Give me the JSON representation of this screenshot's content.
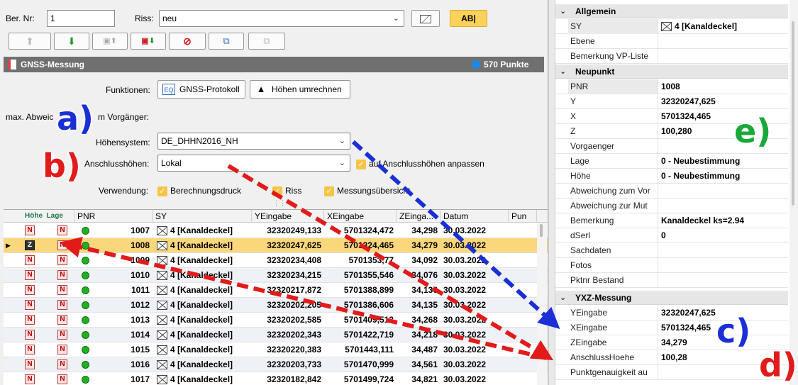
{
  "header": {
    "ber_nr_label": "Ber. Nr:",
    "ber_nr_value": "1",
    "riss_label": "Riss:",
    "riss_value": "neu",
    "ab_button": "AB|"
  },
  "section": {
    "title": "GNSS-Messung",
    "count": "570 Punkte"
  },
  "form": {
    "funktionen_label": "Funktionen:",
    "gnss_protokoll_button": "GNSS-Protokoll",
    "hoehen_umrechnen_button": "Höhen umrechnen",
    "max_abw_label_1": "max. Abweic",
    "max_abw_label_2": "m Vorgänger:",
    "hoehensystem_label": "Höhensystem:",
    "hoehensystem_value": "DE_DHHN2016_NH",
    "anschlusshoehen_label": "Anschlusshöhen:",
    "anschlusshoehen_value": "Lokal",
    "anpassen_label": "auf Anschlusshöhen anpassen",
    "verwendung_label": "Verwendung:",
    "berechnungsdruck_label": "Berechnungsdruck",
    "riss_chk_label": "Riss",
    "messungsuebersicht_label": "Messungsübersicht"
  },
  "grid": {
    "columns": [
      "Höhe",
      "Lage",
      "PNR",
      "SY",
      "YEingabe",
      "XEingabe",
      "ZEinga...",
      "Datum",
      "Pun"
    ],
    "rows": [
      {
        "h": "N",
        "l": "N",
        "pnr": "1007",
        "sy": "4 [Kanaldeckel]",
        "y": "32320249,133",
        "x": "5701324,472",
        "z": "34,298",
        "d": "30.03.2022"
      },
      {
        "h": "Z",
        "l": "N",
        "pnr": "1008",
        "sy": "4 [Kanaldeckel]",
        "y": "32320247,625",
        "x": "5701324,465",
        "z": "34,279",
        "d": "30.03.2022"
      },
      {
        "h": "N",
        "l": "N",
        "pnr": "1009",
        "sy": "4 [Kanaldeckel]",
        "y": "32320234,408",
        "x": "5701353,77",
        "z": "34,092",
        "d": "30.03.2022"
      },
      {
        "h": "N",
        "l": "N",
        "pnr": "1010",
        "sy": "4 [Kanaldeckel]",
        "y": "32320234,215",
        "x": "5701355,546",
        "z": "34,076",
        "d": "30.03.2022"
      },
      {
        "h": "N",
        "l": "N",
        "pnr": "1011",
        "sy": "4 [Kanaldeckel]",
        "y": "32320217,872",
        "x": "5701388,899",
        "z": "34,136",
        "d": "30.03.2022"
      },
      {
        "h": "N",
        "l": "N",
        "pnr": "1012",
        "sy": "4 [Kanaldeckel]",
        "y": "32320202,205",
        "x": "5701386,606",
        "z": "34,135",
        "d": "30.03.2022"
      },
      {
        "h": "N",
        "l": "N",
        "pnr": "1013",
        "sy": "4 [Kanaldeckel]",
        "y": "32320202,585",
        "x": "5701409,513",
        "z": "34,268",
        "d": "30.03.2022"
      },
      {
        "h": "N",
        "l": "N",
        "pnr": "1014",
        "sy": "4 [Kanaldeckel]",
        "y": "32320202,343",
        "x": "5701422,719",
        "z": "34,218",
        "d": "30.03.2022"
      },
      {
        "h": "N",
        "l": "N",
        "pnr": "1015",
        "sy": "4 [Kanaldeckel]",
        "y": "32320220,383",
        "x": "5701443,111",
        "z": "34,487",
        "d": "30.03.2022"
      },
      {
        "h": "N",
        "l": "N",
        "pnr": "1016",
        "sy": "4 [Kanaldeckel]",
        "y": "32320203,733",
        "x": "5701470,999",
        "sz": "",
        "z": "34,561",
        "d": "30.03.2022"
      },
      {
        "h": "N",
        "l": "N",
        "pnr": "1017",
        "sy": "4 [Kanaldeckel]",
        "y": "32320182,842",
        "x": "5701499,724",
        "z": "34,821",
        "d": "30.03.2022"
      }
    ]
  },
  "props": {
    "allgemein": "Allgemein",
    "sy_key": "SY",
    "sy_val": "4 [Kanaldeckel]",
    "ebene_key": "Ebene",
    "bem_vp_key": "Bemerkung VP-Liste",
    "neupunkt": "Neupunkt",
    "pnr_key": "PNR",
    "pnr_val": "1008",
    "y_key": "Y",
    "y_val": "32320247,625",
    "x_key": "X",
    "x_val": "5701324,465",
    "z_key": "Z",
    "z_val": "100,280",
    "vorgaenger_key": "Vorgaenger",
    "lage_key": "Lage",
    "lage_val": "0 - Neubestimmung",
    "hoehe_key": "Höhe",
    "hoehe_val": "0 - Neubestimmung",
    "abw_vor_key": "Abweichung zum Vor",
    "abw_mut_key": "Abweichung zur Mut",
    "bemerkung_key": "Bemerkung",
    "bemerkung_val": "Kanaldeckel ks=2.94",
    "dserl_key": "dSerl",
    "dserl_val": "0",
    "sachdaten_key": "Sachdaten",
    "fotos_key": "Fotos",
    "pktnr_key": "Pktnr Bestand",
    "yxz": "YXZ-Messung",
    "yeingabe_key": "YEingabe",
    "yeingabe_val": "32320247,625",
    "xeingabe_key": "XEingabe",
    "xeingabe_val": "5701324,465",
    "zeingabe_key": "ZEingabe",
    "zeingabe_val": "34,279",
    "anschluss_key": "AnschlussHoehe",
    "anschluss_val": "100,28",
    "punktgen_key": "Punktgenauigkeit au"
  },
  "annotations": {
    "a": "a)",
    "b": "b)",
    "c": "c)",
    "d": "d)",
    "e": "e)"
  },
  "colors": {
    "accent_yellow": "#f7c545",
    "annot_blue": "#1a2fd6",
    "annot_red": "#e11b1b",
    "annot_green": "#19a83a",
    "selected_row": "#fbd77c"
  }
}
